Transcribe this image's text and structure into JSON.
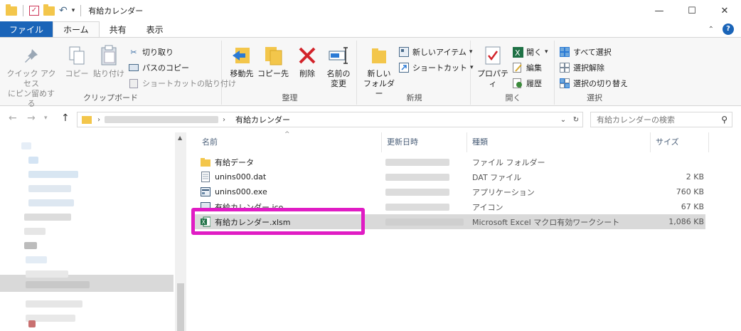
{
  "window": {
    "title": "有給カレンダー",
    "buttons": {
      "minimize": "—",
      "maximize": "☐",
      "close": "✕"
    }
  },
  "ribbon_tabs": [
    "ファイル",
    "ホーム",
    "共有",
    "表示"
  ],
  "ribbon": {
    "clipboard": {
      "label": "クリップボード",
      "pin": "クイック アクセス\nにピン留めする",
      "copy": "コピー",
      "paste": "貼り付け",
      "cut": "切り取り",
      "copy_path": "パスのコピー",
      "paste_shortcut": "ショートカットの貼り付け"
    },
    "organize": {
      "label": "整理",
      "move_to": "移動先",
      "copy_to": "コピー先",
      "delete": "削除",
      "rename": "名前の\n変更"
    },
    "new": {
      "label": "新規",
      "new_folder": "新しい\nフォルダー",
      "new_item": "新しいアイテム",
      "shortcut": "ショートカット"
    },
    "open": {
      "label": "開く",
      "properties": "プロパティ",
      "open": "開く",
      "edit": "編集",
      "history": "履歴"
    },
    "select": {
      "label": "選択",
      "select_all": "すべて選択",
      "select_none": "選択解除",
      "invert": "選択の切り替え"
    }
  },
  "address": {
    "current_folder": "有給カレンダー",
    "search_placeholder": "有給カレンダーの検索"
  },
  "columns": {
    "name": "名前",
    "date": "更新日時",
    "type": "種類",
    "size": "サイズ"
  },
  "files": [
    {
      "name": "有給データ",
      "type": "ファイル フォルダー",
      "size": "",
      "icon": "folder-icon"
    },
    {
      "name": "unins000.dat",
      "type": "DAT ファイル",
      "size": "2 KB",
      "icon": "dat-file-icon"
    },
    {
      "name": "unins000.exe",
      "type": "アプリケーション",
      "size": "760 KB",
      "icon": "exe-file-icon"
    },
    {
      "name": "有給カレンダー.ico",
      "type": "アイコン",
      "size": "67 KB",
      "icon": "ico-file-icon"
    },
    {
      "name": "有給カレンダー.xlsm",
      "type": "Microsoft Excel マクロ有効ワークシート",
      "size": "1,086 KB",
      "icon": "excel-file-icon"
    }
  ],
  "colors": {
    "accent": "#1a64b8",
    "highlight": "#e01cc4",
    "folder": "#f3c64b",
    "excel": "#1e7145"
  }
}
